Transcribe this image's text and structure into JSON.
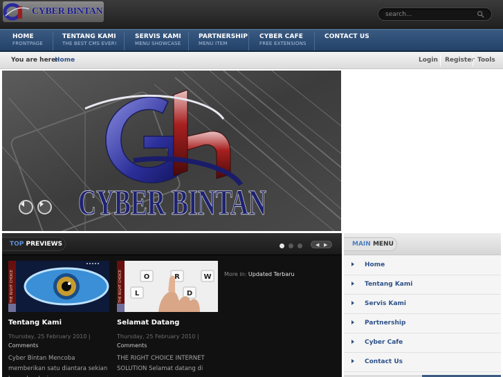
{
  "site": {
    "logo_text": "CYBER BINTAN"
  },
  "search": {
    "placeholder": "search..."
  },
  "nav": [
    {
      "title": "HOME",
      "sub": "FRONTPAGE"
    },
    {
      "title": "TENTANG KAMI",
      "sub": "THE BEST CMS EVER!"
    },
    {
      "title": "SERVIS KAMI",
      "sub": "MENU SHOWCASE"
    },
    {
      "title": "PARTNERSHIP",
      "sub": "MENU ITEM"
    },
    {
      "title": "CYBER CAFE",
      "sub": "FREE EXTENSIONS"
    },
    {
      "title": "CONTACT US",
      "sub": ""
    }
  ],
  "breadcrumb": {
    "label": "You are here:",
    "home": "Home"
  },
  "toolbar": {
    "login": "Login",
    "register": "Register",
    "tools": "Tools"
  },
  "slideshow": {
    "logo_text": "CYBER BINTAN"
  },
  "previews": {
    "heading_accent": "TOP",
    "heading_rest": "PREVIEWS",
    "more_in_label": "More in:",
    "more_in_link": "Updated Terbaru",
    "thumb_vertical_text": "THE RIGHT CHOICE",
    "keyboard_letters": [
      "O",
      "R",
      "W",
      "L",
      "D"
    ],
    "articles": [
      {
        "title": "Tentang Kami",
        "date": "Thursday, 25 February 2010 |",
        "comments": "Comments",
        "text": "Cyber Bintan Mencoba memberikan satu diantara sekian banyak solusi"
      },
      {
        "title": "Selamat Datang",
        "date": "Thursday, 25 February 2010 |",
        "comments": "Comments",
        "text": "THE RIGHT CHOICE INTERNET SOLUTION Selamat datang di"
      }
    ]
  },
  "main_menu": {
    "heading_accent": "MAIN",
    "heading_rest": "MENU",
    "items": [
      "Home",
      "Tentang Kami",
      "Servis Kami",
      "Partnership",
      "Cyber Cafe",
      "Contact Us"
    ]
  },
  "colors": {
    "nav_blue": "#2f4f78",
    "link_blue": "#2d5189",
    "accent_blue": "#5d8ed6"
  }
}
